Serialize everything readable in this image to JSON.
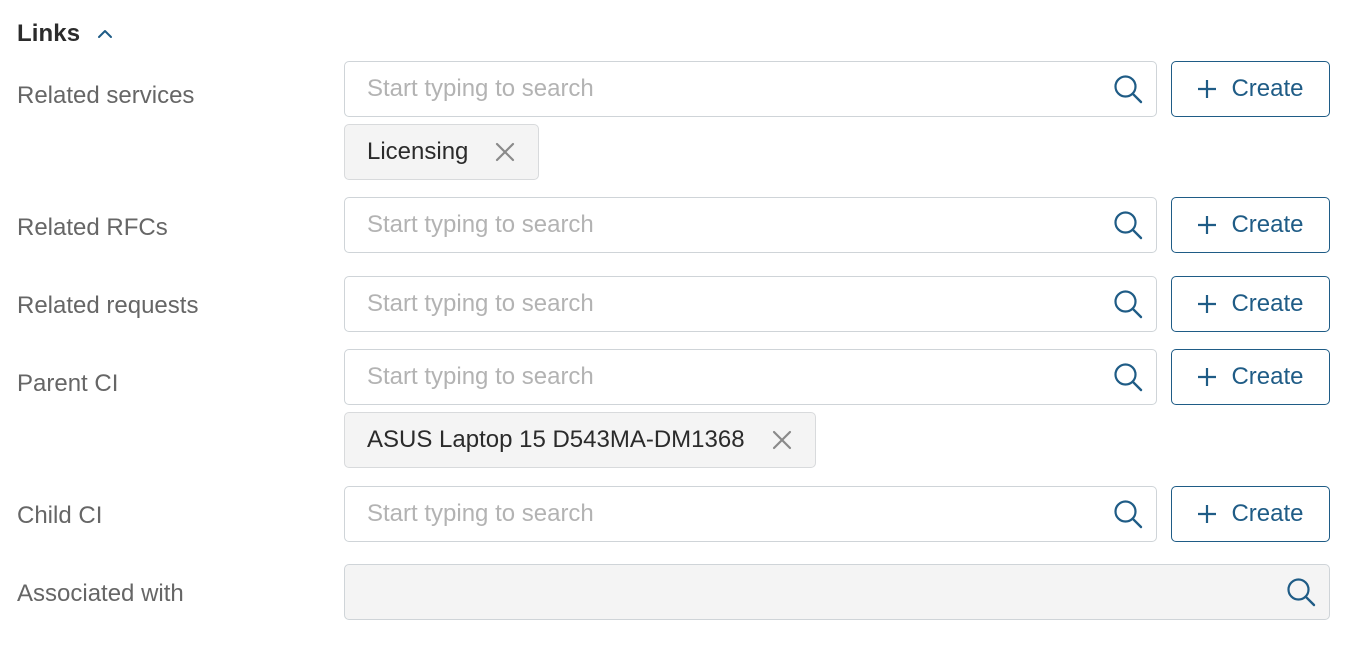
{
  "section": {
    "title": "Links",
    "collapse_icon": "chevron-up-icon"
  },
  "colors": {
    "accent": "#1f5c86",
    "label": "#666666",
    "placeholder": "#b3b3b3",
    "chip_bg": "#f4f4f4",
    "border": "#cfd4d8"
  },
  "fields": {
    "related_services": {
      "label": "Related services",
      "placeholder": "Start typing to search",
      "create_label": "Create",
      "chips": [
        "Licensing"
      ]
    },
    "related_rfcs": {
      "label": "Related RFCs",
      "placeholder": "Start typing to search",
      "create_label": "Create"
    },
    "related_requests": {
      "label": "Related requests",
      "placeholder": "Start typing to search",
      "create_label": "Create"
    },
    "parent_ci": {
      "label": "Parent CI",
      "placeholder": "Start typing to search",
      "create_label": "Create",
      "chips": [
        "ASUS Laptop 15 D543MA-DM1368"
      ]
    },
    "child_ci": {
      "label": "Child CI",
      "placeholder": "Start typing to search",
      "create_label": "Create"
    },
    "associated_with": {
      "label": "Associated with",
      "placeholder": ""
    }
  }
}
